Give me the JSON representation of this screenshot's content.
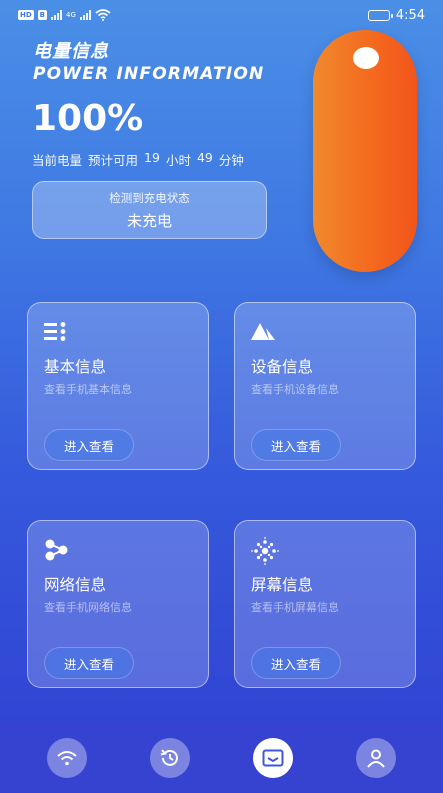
{
  "status_bar": {
    "time": "4:54",
    "chip_hd": "HD",
    "chip_b": "B",
    "network_tag": "4G",
    "icons": [
      "hd-icon",
      "bluetooth-icon",
      "signal-icon",
      "signal-4g-icon",
      "wifi-icon",
      "battery-icon"
    ]
  },
  "header": {
    "title_cn": "电量信息",
    "title_en": "POWER INFORMATION",
    "percent": "100%",
    "estimate_prefix": "当前电量",
    "estimate_label": "预计可用",
    "estimate_hours": "19",
    "estimate_hours_unit": "小时",
    "estimate_minutes": "49",
    "estimate_minutes_unit": "分钟"
  },
  "charge": {
    "label": "检测到充电状态",
    "value": "未充电"
  },
  "battery_level": 1.0,
  "colors": {
    "accent_orange": "#f46a1e",
    "bg_top": "#4a8fe6",
    "bg_bottom": "#2f3fd2"
  },
  "cards": [
    {
      "icon": "list-icon",
      "name": "基本信息",
      "sub": "查看手机基本信息",
      "button": "进入查看"
    },
    {
      "icon": "triangle-icon",
      "name": "设备信息",
      "sub": "查看手机设备信息",
      "button": "进入查看"
    },
    {
      "icon": "network-icon",
      "name": "网络信息",
      "sub": "查看手机网络信息",
      "button": "进入查看"
    },
    {
      "icon": "screen-icon",
      "name": "屏幕信息",
      "sub": "查看手机屏幕信息",
      "button": "进入查看"
    }
  ],
  "nav": [
    {
      "icon": "wifi-icon",
      "active": false
    },
    {
      "icon": "history-icon",
      "active": false
    },
    {
      "icon": "mail-icon",
      "active": true
    },
    {
      "icon": "user-icon",
      "active": false
    }
  ]
}
